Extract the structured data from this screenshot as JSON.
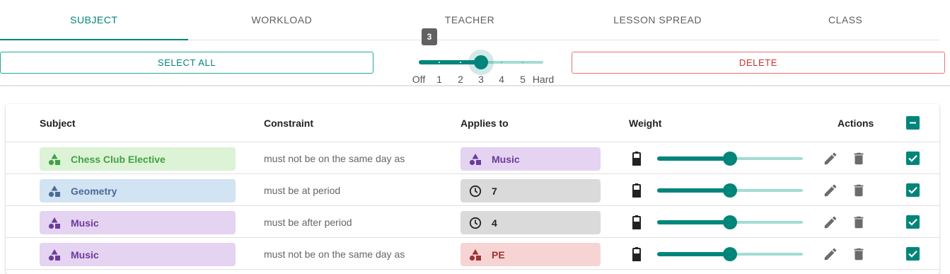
{
  "tabs": [
    {
      "label": "SUBJECT",
      "active": true
    },
    {
      "label": "WORKLOAD",
      "active": false
    },
    {
      "label": "TEACHER",
      "active": false
    },
    {
      "label": "LESSON SPREAD",
      "active": false
    },
    {
      "label": "CLASS",
      "active": false
    }
  ],
  "toolbar": {
    "select_all_label": "SELECT ALL",
    "delete_label": "DELETE",
    "difficulty": {
      "value": 3,
      "value_label": "3",
      "levels": [
        "Off",
        "1",
        "2",
        "3",
        "4",
        "5",
        "Hard"
      ],
      "selected_index": 3
    }
  },
  "table": {
    "headers": {
      "subject": "Subject",
      "constraint": "Constraint",
      "applies_to": "Applies to",
      "weight": "Weight",
      "actions": "Actions"
    },
    "select_all_state": "indeterminate",
    "rows": [
      {
        "subject": "Chess Club Elective",
        "subject_color": "green",
        "constraint": "must not be on the same day as",
        "applies_to": "Music",
        "applies_type": "subject",
        "applies_color": "purple",
        "weight_fraction": 0.5,
        "checked": true
      },
      {
        "subject": "Geometry",
        "subject_color": "blue",
        "constraint": "must be at period",
        "applies_to": "7",
        "applies_type": "period",
        "applies_color": "grey",
        "weight_fraction": 0.5,
        "checked": true
      },
      {
        "subject": "Music",
        "subject_color": "purple",
        "constraint": "must be after period",
        "applies_to": "4",
        "applies_type": "period",
        "applies_color": "grey",
        "weight_fraction": 0.5,
        "checked": true
      },
      {
        "subject": "Music",
        "subject_color": "purple",
        "constraint": "must not be on the same day as",
        "applies_to": "PE",
        "applies_type": "subject",
        "applies_color": "red",
        "weight_fraction": 0.5,
        "checked": true
      }
    ]
  },
  "colors": {
    "accent": "#00857a",
    "accent_light": "#a3dcd4",
    "danger": "#d32f2f",
    "chip_green_icon": "#43a047",
    "chip_blue_icon": "#4a6b95",
    "chip_purple_icon": "#6a3b9c",
    "chip_red_icon": "#9b3535"
  },
  "icons": {
    "subject": "shapes-icon",
    "period": "clock-icon",
    "weight": "battery-icon",
    "edit": "pencil-icon",
    "delete": "trash-icon",
    "checked": "checkbox-checked-icon",
    "indeterminate": "checkbox-indeterminate-icon"
  }
}
